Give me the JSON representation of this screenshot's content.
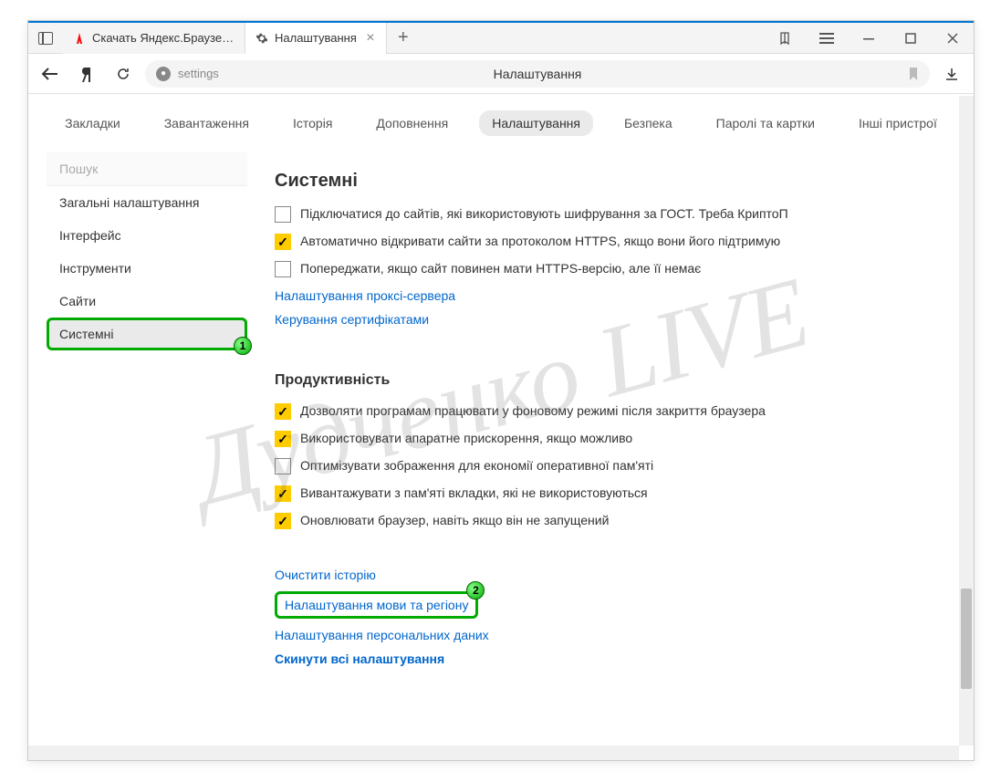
{
  "tabs": [
    {
      "icon_color": "#ff0000",
      "title": "Скачать Яндекс.Браузер д"
    },
    {
      "icon": "gear",
      "title": "Налаштування"
    }
  ],
  "address": {
    "text": "settings",
    "center_label": "Налаштування"
  },
  "top_nav": [
    "Закладки",
    "Завантаження",
    "Історія",
    "Доповнення",
    "Налаштування",
    "Безпека",
    "Паролі та картки",
    "Інші пристрої"
  ],
  "top_nav_active_index": 4,
  "sidebar": {
    "search_placeholder": "Пошук",
    "items": [
      "Загальні налаштування",
      "Інтерфейс",
      "Інструменти",
      "Сайти",
      "Системні"
    ],
    "active_index": 4,
    "highlight_index": 4,
    "highlight_badge": "1"
  },
  "settings": {
    "section1_title": "Системні",
    "section1_items": [
      {
        "checked": false,
        "label": "Підключатися до сайтів, які використовують шифрування за ГОСТ. Треба КриптоП"
      },
      {
        "checked": true,
        "label": "Автоматично відкривати сайти за протоколом HTTPS, якщо вони його підтримую"
      },
      {
        "checked": false,
        "label": "Попереджати, якщо сайт повинен мати HTTPS-версію, але її немає"
      }
    ],
    "section1_links": [
      "Налаштування проксі-сервера",
      "Керування сертифікатами"
    ],
    "section2_title": "Продуктивність",
    "section2_items": [
      {
        "checked": true,
        "label": "Дозволяти програмам працювати у фоновому режимі після закриття браузера"
      },
      {
        "checked": true,
        "label": "Використовувати апаратне прискорення, якщо можливо"
      },
      {
        "checked": false,
        "label": "Оптимізувати зображення для економії оперативної пам'яті"
      },
      {
        "checked": true,
        "label": "Вивантажувати з пам'яті вкладки, які не використовуються"
      },
      {
        "checked": true,
        "label": "Оновлювати браузер, навіть якщо він не запущений"
      }
    ],
    "bottom_links": [
      "Очистити історію",
      "Налаштування мови та регіону",
      "Налаштування персональних даних",
      "Скинути всі налаштування"
    ],
    "bottom_highlight_index": 1,
    "bottom_highlight_badge": "2"
  },
  "watermark": "Дудченко LIVE"
}
